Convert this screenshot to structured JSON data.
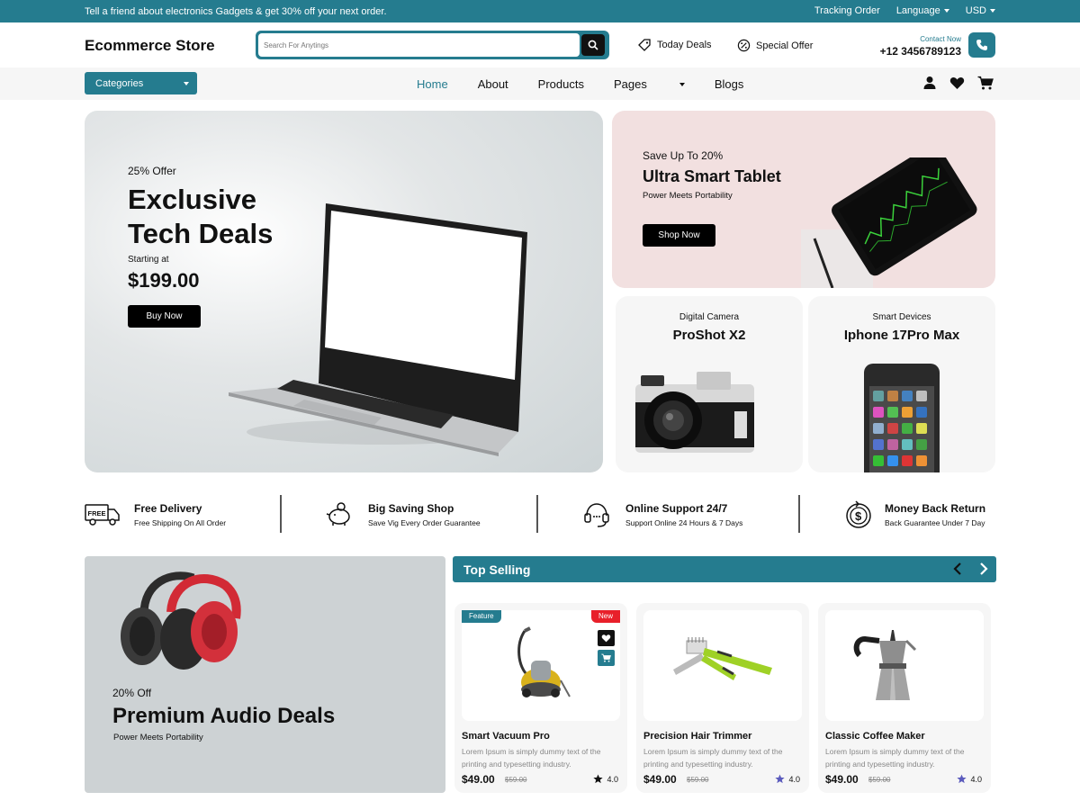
{
  "topbar": {
    "promo": "Tell a friend about electronics Gadgets & get 30% off your next order.",
    "tracking": "Tracking Order",
    "language": "Language",
    "currency": "USD"
  },
  "header": {
    "brand": "Ecommerce Store",
    "search_placeholder": "Search For Anytings",
    "today_deals": "Today Deals",
    "special_offer": "Special Offer",
    "contact_label": "Contact Now",
    "phone": "+12 3456789123"
  },
  "nav": {
    "categories": "Categories",
    "items": [
      "Home",
      "About",
      "Products",
      "Pages",
      "Blogs"
    ]
  },
  "hero": {
    "offer": "25% Offer",
    "title_line1": "Exclusive",
    "title_line2": "Tech Deals",
    "starting": "Starting at",
    "price": "$199.00",
    "button": "Buy Now"
  },
  "tablet": {
    "save": "Save Up To 20%",
    "title": "Ultra Smart Tablet",
    "sub": "Power Meets Portability",
    "button": "Shop Now"
  },
  "camera": {
    "category": "Digital Camera",
    "title": "ProShot X2"
  },
  "phone_card": {
    "category": "Smart Devices",
    "title": "Iphone 17Pro Max"
  },
  "features": [
    {
      "title": "Free Delivery",
      "sub": "Free Shipping On All Order",
      "icon": "truck-icon"
    },
    {
      "title": "Big Saving Shop",
      "sub": "Save Vig Every Order Guarantee",
      "icon": "piggy-bank-icon"
    },
    {
      "title": "Online Support 24/7",
      "sub": "Support Online 24 Hours & 7 Days",
      "icon": "headset-icon"
    },
    {
      "title": "Money Back Return",
      "sub": "Back Guarantee Under 7 Day",
      "icon": "money-back-icon"
    }
  ],
  "truck_text": "FREE",
  "audio": {
    "off": "20% Off",
    "title": "Premium Audio Deals",
    "sub": "Power Meets Portability"
  },
  "top_selling": {
    "title": "Top Selling",
    "products": [
      {
        "name": "Smart Vacuum Pro",
        "desc": "Lorem Ipsum is simply dummy text of the printing and typesetting industry.",
        "price": "$49.00",
        "old_price": "$59.00",
        "rating": "4.0",
        "badge_left": "Feature",
        "badge_right": "New"
      },
      {
        "name": "Precision Hair Trimmer",
        "desc": "Lorem Ipsum is simply dummy text of the printing and typesetting industry.",
        "price": "$49.00",
        "old_price": "$59.00",
        "rating": "4.0"
      },
      {
        "name": "Classic Coffee Maker",
        "desc": "Lorem Ipsum is simply dummy text of the printing and typesetting industry.",
        "price": "$49.00",
        "old_price": "$59.00",
        "rating": "4.0"
      }
    ]
  },
  "colors": {
    "accent": "#257c8f",
    "badge_new": "#e8202a",
    "star_purple": "#5b5bbd"
  }
}
